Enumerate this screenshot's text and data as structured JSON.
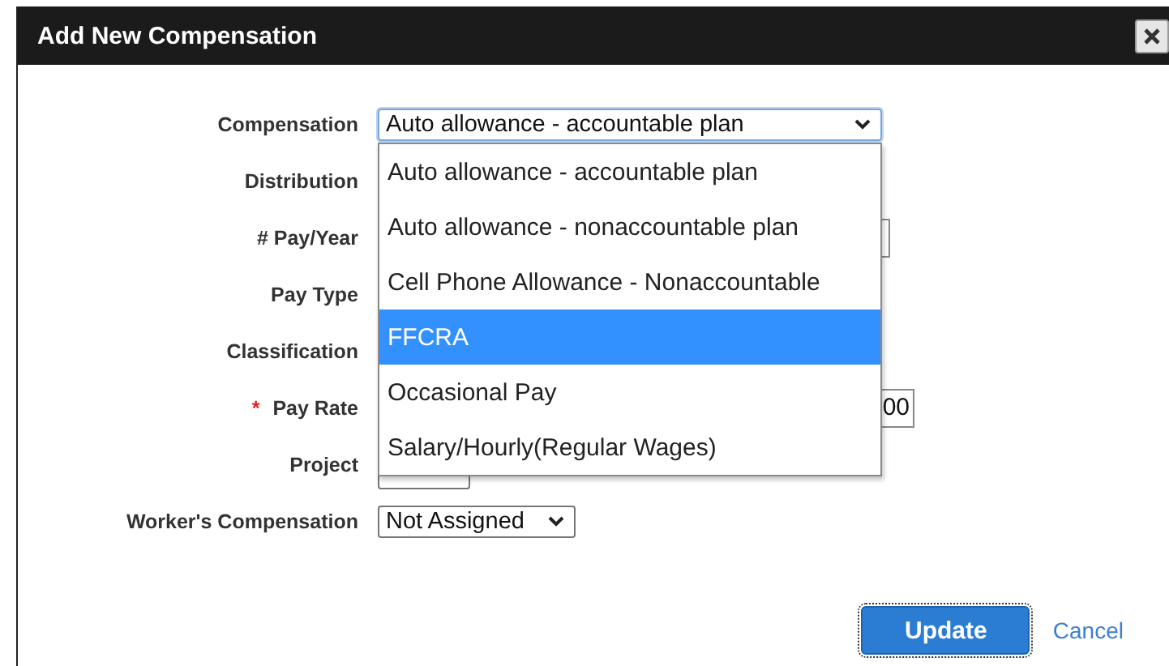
{
  "dialog": {
    "title": "Add New Compensation"
  },
  "fields": [
    {
      "label": "Compensation",
      "kind": "select",
      "value": "Auto allowance - accountable plan",
      "focused": true
    },
    {
      "label": "Distribution",
      "kind": "covered"
    },
    {
      "label": "# Pay/Year",
      "kind": "input"
    },
    {
      "label": "Pay Type",
      "kind": "covered"
    },
    {
      "label": "Classification",
      "kind": "covered"
    },
    {
      "label": "Pay Rate",
      "kind": "input",
      "required_mark": "*",
      "value": "00"
    },
    {
      "label": "Project",
      "kind": "select"
    },
    {
      "label": "Worker's Compensation",
      "kind": "select",
      "value": "Not Assigned",
      "focused": false
    }
  ],
  "dropdown": {
    "options": [
      {
        "label": "Auto allowance - accountable plan",
        "selected": false
      },
      {
        "label": "Auto allowance - nonaccountable plan",
        "selected": false
      },
      {
        "label": "Cell Phone Allowance - Nonaccountable",
        "selected": false
      },
      {
        "label": "FFCRA",
        "selected": true
      },
      {
        "label": "Occasional Pay",
        "selected": false
      },
      {
        "label": "Salary/Hourly(Regular Wages)",
        "selected": false
      }
    ]
  },
  "buttons": [
    {
      "label": "Update",
      "kind": "primary"
    },
    {
      "label": "Cancel",
      "kind": "link"
    }
  ]
}
